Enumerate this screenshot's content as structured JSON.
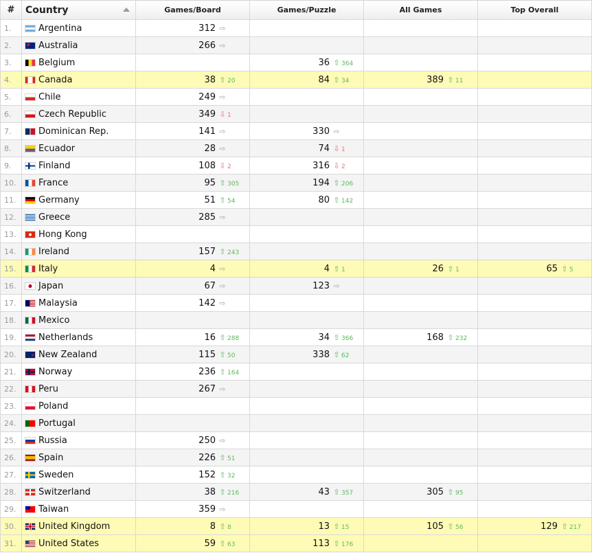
{
  "columns": {
    "rank": "#",
    "country": "Country",
    "board": "Games/Board",
    "puzzle": "Games/Puzzle",
    "all": "All Games",
    "top": "Top Overall"
  },
  "icons": {
    "up": "arrow-up-icon",
    "down": "arrow-down-icon",
    "same": "arrow-right-icon",
    "sort": "sort-asc-icon"
  },
  "colors": {
    "highlight": "#fefbb6",
    "up": "#5cb85c",
    "down": "#e07575",
    "same": "#aaaaaa"
  },
  "rows": [
    {
      "rank": "1.",
      "country": "Argentina",
      "flag": "ar",
      "board": {
        "v": "312",
        "d": "same",
        "c": ""
      }
    },
    {
      "rank": "2.",
      "country": "Australia",
      "flag": "au",
      "board": {
        "v": "266",
        "d": "same",
        "c": ""
      }
    },
    {
      "rank": "3.",
      "country": "Belgium",
      "flag": "be",
      "puzzle": {
        "v": "36",
        "d": "up",
        "c": "364"
      }
    },
    {
      "rank": "4.",
      "country": "Canada",
      "flag": "ca",
      "highlight": true,
      "board": {
        "v": "38",
        "d": "up",
        "c": "20"
      },
      "puzzle": {
        "v": "84",
        "d": "up",
        "c": "34"
      },
      "all": {
        "v": "389",
        "d": "up",
        "c": "11"
      }
    },
    {
      "rank": "5.",
      "country": "Chile",
      "flag": "cl",
      "board": {
        "v": "249",
        "d": "same",
        "c": ""
      }
    },
    {
      "rank": "6.",
      "country": "Czech Republic",
      "flag": "cz",
      "board": {
        "v": "349",
        "d": "down",
        "c": "1"
      }
    },
    {
      "rank": "7.",
      "country": "Dominican Rep.",
      "flag": "do",
      "board": {
        "v": "141",
        "d": "same",
        "c": ""
      },
      "puzzle": {
        "v": "330",
        "d": "same",
        "c": ""
      }
    },
    {
      "rank": "8.",
      "country": "Ecuador",
      "flag": "ec",
      "board": {
        "v": "28",
        "d": "same",
        "c": ""
      },
      "puzzle": {
        "v": "74",
        "d": "down",
        "c": "1"
      }
    },
    {
      "rank": "9.",
      "country": "Finland",
      "flag": "fi",
      "board": {
        "v": "108",
        "d": "down",
        "c": "2"
      },
      "puzzle": {
        "v": "316",
        "d": "down",
        "c": "2"
      }
    },
    {
      "rank": "10.",
      "country": "France",
      "flag": "fr",
      "board": {
        "v": "95",
        "d": "up",
        "c": "305"
      },
      "puzzle": {
        "v": "194",
        "d": "up",
        "c": "206"
      }
    },
    {
      "rank": "11.",
      "country": "Germany",
      "flag": "de",
      "board": {
        "v": "51",
        "d": "up",
        "c": "54"
      },
      "puzzle": {
        "v": "80",
        "d": "up",
        "c": "142"
      }
    },
    {
      "rank": "12.",
      "country": "Greece",
      "flag": "gr",
      "board": {
        "v": "285",
        "d": "same",
        "c": ""
      }
    },
    {
      "rank": "13.",
      "country": "Hong Kong",
      "flag": "hk"
    },
    {
      "rank": "14.",
      "country": "Ireland",
      "flag": "ie",
      "board": {
        "v": "157",
        "d": "up",
        "c": "243"
      }
    },
    {
      "rank": "15.",
      "country": "Italy",
      "flag": "it",
      "highlight": true,
      "board": {
        "v": "4",
        "d": "same",
        "c": ""
      },
      "puzzle": {
        "v": "4",
        "d": "up",
        "c": "1"
      },
      "all": {
        "v": "26",
        "d": "up",
        "c": "1"
      },
      "top": {
        "v": "65",
        "d": "up",
        "c": "5"
      }
    },
    {
      "rank": "16.",
      "country": "Japan",
      "flag": "jp",
      "board": {
        "v": "67",
        "d": "same",
        "c": ""
      },
      "puzzle": {
        "v": "123",
        "d": "same",
        "c": ""
      }
    },
    {
      "rank": "17.",
      "country": "Malaysia",
      "flag": "my",
      "board": {
        "v": "142",
        "d": "same",
        "c": ""
      }
    },
    {
      "rank": "18.",
      "country": "Mexico",
      "flag": "mx"
    },
    {
      "rank": "19.",
      "country": "Netherlands",
      "flag": "nl",
      "board": {
        "v": "16",
        "d": "up",
        "c": "288"
      },
      "puzzle": {
        "v": "34",
        "d": "up",
        "c": "366"
      },
      "all": {
        "v": "168",
        "d": "up",
        "c": "232"
      }
    },
    {
      "rank": "20.",
      "country": "New Zealand",
      "flag": "nz",
      "board": {
        "v": "115",
        "d": "up",
        "c": "50"
      },
      "puzzle": {
        "v": "338",
        "d": "up",
        "c": "62"
      }
    },
    {
      "rank": "21.",
      "country": "Norway",
      "flag": "no",
      "board": {
        "v": "236",
        "d": "up",
        "c": "164"
      }
    },
    {
      "rank": "22.",
      "country": "Peru",
      "flag": "pe",
      "board": {
        "v": "267",
        "d": "same",
        "c": ""
      }
    },
    {
      "rank": "23.",
      "country": "Poland",
      "flag": "pl"
    },
    {
      "rank": "24.",
      "country": "Portugal",
      "flag": "pt"
    },
    {
      "rank": "25.",
      "country": "Russia",
      "flag": "ru",
      "board": {
        "v": "250",
        "d": "same",
        "c": ""
      }
    },
    {
      "rank": "26.",
      "country": "Spain",
      "flag": "es",
      "board": {
        "v": "226",
        "d": "up",
        "c": "51"
      }
    },
    {
      "rank": "27.",
      "country": "Sweden",
      "flag": "se",
      "board": {
        "v": "152",
        "d": "up",
        "c": "32"
      }
    },
    {
      "rank": "28.",
      "country": "Switzerland",
      "flag": "ch",
      "board": {
        "v": "38",
        "d": "up",
        "c": "216"
      },
      "puzzle": {
        "v": "43",
        "d": "up",
        "c": "357"
      },
      "all": {
        "v": "305",
        "d": "up",
        "c": "95"
      }
    },
    {
      "rank": "29.",
      "country": "Taiwan",
      "flag": "tw",
      "board": {
        "v": "359",
        "d": "same",
        "c": ""
      }
    },
    {
      "rank": "30.",
      "country": "United Kingdom",
      "flag": "gb",
      "highlight": true,
      "board": {
        "v": "8",
        "d": "up",
        "c": "8"
      },
      "puzzle": {
        "v": "13",
        "d": "up",
        "c": "15"
      },
      "all": {
        "v": "105",
        "d": "up",
        "c": "56"
      },
      "top": {
        "v": "129",
        "d": "up",
        "c": "217"
      }
    },
    {
      "rank": "31.",
      "country": "United States",
      "flag": "us",
      "highlight": true,
      "board": {
        "v": "59",
        "d": "up",
        "c": "63"
      },
      "puzzle": {
        "v": "113",
        "d": "up",
        "c": "176"
      }
    }
  ]
}
